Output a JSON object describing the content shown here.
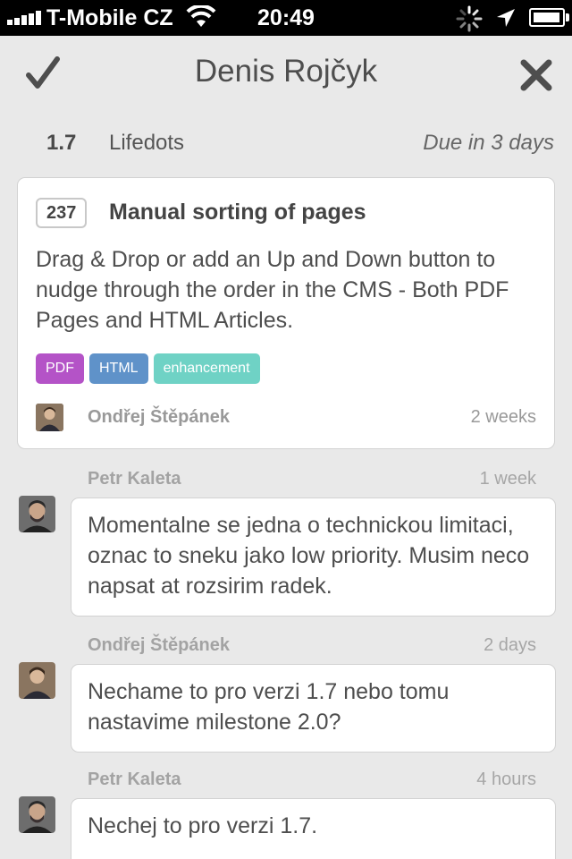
{
  "status_bar": {
    "carrier": "T-Mobile CZ",
    "time": "20:49",
    "signal_bars": 5,
    "battery_level": 0.9,
    "icons": [
      "signal-icon",
      "wifi-icon",
      "activity-spinner-icon",
      "location-arrow-icon",
      "battery-icon"
    ]
  },
  "nav": {
    "title": "Denis Rojčyk",
    "confirm_icon": "checkmark-icon",
    "close_icon": "close-icon"
  },
  "issue_meta": {
    "version": "1.7",
    "project": "Lifedots",
    "due": "Due in 3 days"
  },
  "issue": {
    "number": "237",
    "title": "Manual sorting of pages",
    "description": "Drag & Drop or add an Up and Down button to nudge through the order in the CMS - Both PDF Pages and HTML Articles.",
    "labels": [
      {
        "text": "PDF",
        "color": "#b453c7"
      },
      {
        "text": "HTML",
        "color": "#5f92c9"
      },
      {
        "text": "enhancement",
        "color": "#6fd2c5"
      }
    ],
    "author": "Ondřej Štěpánek",
    "age": "2 weeks"
  },
  "comments": [
    {
      "author": "Petr Kaleta",
      "time": "1 week",
      "text": "Momentalne se jedna o technickou limitaci, oznac to sneku jako low priority. Musim neco napsat at rozsirim radek."
    },
    {
      "author": "Ondřej Štěpánek",
      "time": "2 days",
      "text": "Nechame to pro verzi 1.7 nebo tomu nastavime milestone 2.0?"
    },
    {
      "author": "Petr Kaleta",
      "time": "4 hours",
      "text": "Nechej to pro verzi 1.7."
    }
  ]
}
